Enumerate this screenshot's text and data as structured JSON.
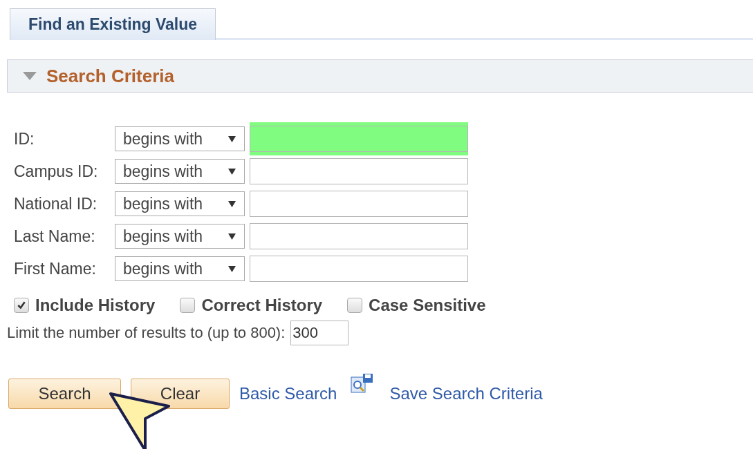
{
  "tabs": [
    {
      "label": "Find an Existing Value",
      "selected": true
    }
  ],
  "section": {
    "title": "Search Criteria",
    "expanded": true
  },
  "criteria": [
    {
      "label": "ID:",
      "operator": "begins with",
      "highlighted": true
    },
    {
      "label": "Campus ID:",
      "operator": "begins with",
      "highlighted": false
    },
    {
      "label": "National ID:",
      "operator": "begins with",
      "highlighted": false
    },
    {
      "label": "Last Name:",
      "operator": "begins with",
      "highlighted": false
    },
    {
      "label": "First Name:",
      "operator": "begins with",
      "highlighted": false
    }
  ],
  "options": [
    {
      "label": "Include History",
      "checked": true
    },
    {
      "label": "Correct History",
      "checked": false
    },
    {
      "label": "Case Sensitive",
      "checked": false
    }
  ],
  "limit": {
    "label": "Limit the number of results to (up to 800):",
    "value": "300"
  },
  "buttons": [
    "Search",
    "Clear"
  ],
  "links": [
    {
      "label": "Basic Search"
    },
    {
      "label": "Save Search Criteria"
    }
  ]
}
